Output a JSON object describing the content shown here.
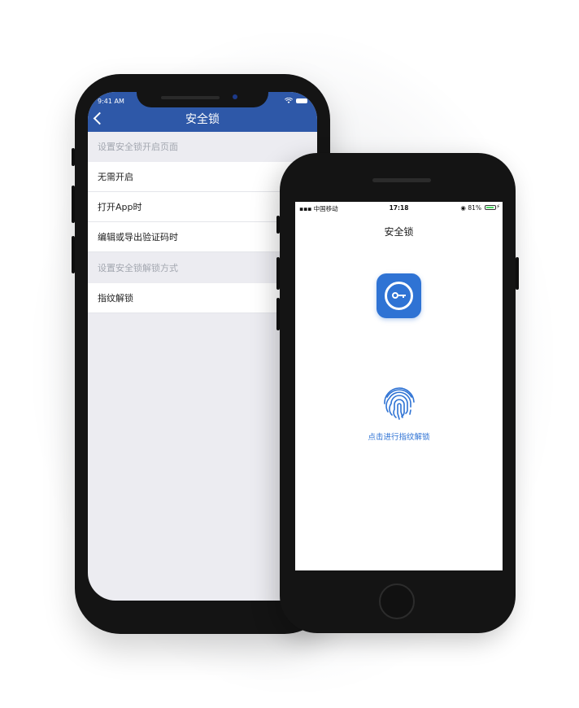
{
  "back_phone": {
    "status_time": "9:41 AM",
    "nav_title": "安全锁",
    "sections": [
      {
        "header": "设置安全锁开启页面",
        "items": [
          "无需开启",
          "打开App时",
          "编辑或导出验证码时"
        ]
      },
      {
        "header": "设置安全锁解锁方式",
        "items": [
          "指纹解锁"
        ]
      }
    ],
    "fingerprint_toggle_on": true
  },
  "front_phone": {
    "carrier": "中国移动",
    "status_time": "17:18",
    "battery": "81%",
    "screen_title": "安全锁",
    "app_icon": "key-in-circle-icon",
    "unlock_icon": "fingerprint-icon",
    "unlock_label": "点击进行指纹解锁"
  },
  "colors": {
    "nav_blue": "#2e58a8",
    "accent_blue": "#2f73d4",
    "toggle_green": "#4cd964"
  }
}
